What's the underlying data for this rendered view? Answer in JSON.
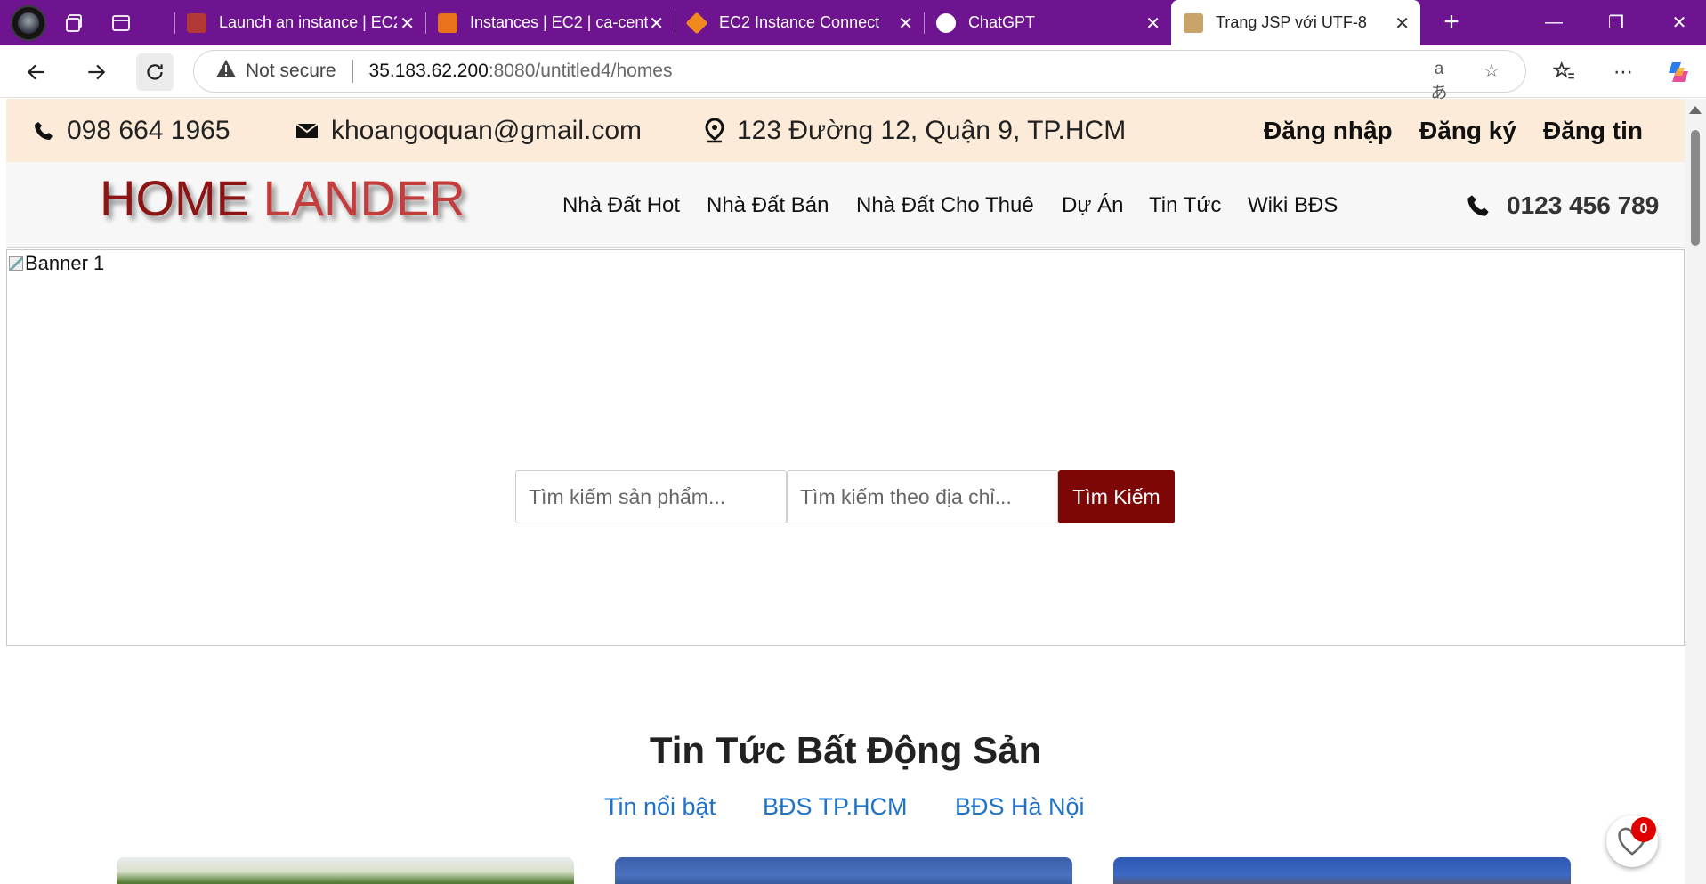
{
  "browser": {
    "tabs": [
      {
        "title": "Launch an instance | EC2",
        "favicon_color": "#b33838"
      },
      {
        "title": "Instances | EC2 | ca-central",
        "favicon_color": "#e8731c"
      },
      {
        "title": "EC2 Instance Connect | EC2",
        "favicon_color": "#f08a1c"
      },
      {
        "title": "ChatGPT",
        "favicon_color": "#ffffff"
      },
      {
        "title": "Trang JSP với UTF-8",
        "favicon_color": "#c9a46a",
        "active": true
      }
    ],
    "address": {
      "security": "Not secure",
      "host": "35.183.62.200",
      "path": ":8080/untitled4/homes"
    },
    "colors": {
      "tabstrip": "#6e1490"
    }
  },
  "topbar": {
    "phone": "098 664 1965",
    "email": "khoangoquan@gmail.com",
    "address": "123 Đường 12, Quận 9, TP.HCM",
    "login": "Đăng nhập",
    "register": "Đăng ký",
    "post": "Đăng tin"
  },
  "header": {
    "logo_part1": "HOME",
    "logo_part2": "LANDER",
    "menu": [
      "Nhà Đất Hot",
      "Nhà Đất Bán",
      "Nhà Đất Cho Thuê",
      "Dự Án",
      "Tin Tức",
      "Wiki BĐS"
    ],
    "hotline": "0123 456 789"
  },
  "banner": {
    "alt_text": "Banner 1",
    "search_product_placeholder": "Tìm kiếm sản phẩm...",
    "search_address_placeholder": "Tìm kiếm theo địa chỉ...",
    "search_button": "Tìm Kiếm"
  },
  "news": {
    "title": "Tin Tức Bất Động Sản",
    "tabs": [
      "Tin nổi bật",
      "BĐS TP.HCM",
      "BĐS Hà Nội"
    ]
  },
  "favorites": {
    "count": "0"
  },
  "colors": {
    "accent": "#7d0707",
    "topbar_bg": "#fbebd8",
    "link": "#1e72c9"
  }
}
